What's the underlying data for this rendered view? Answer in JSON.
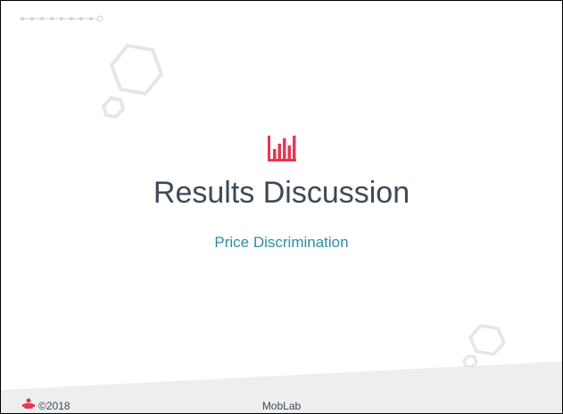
{
  "slide": {
    "title": "Results Discussion",
    "subtitle": "Price Discrimination",
    "icon": "bar-chart-icon",
    "accent_color": "#e53950",
    "subtitle_color": "#2b8fa8"
  },
  "footer": {
    "copyright": "©2018",
    "company": "MobLab",
    "logo_icon": "moblab-logo-icon"
  }
}
